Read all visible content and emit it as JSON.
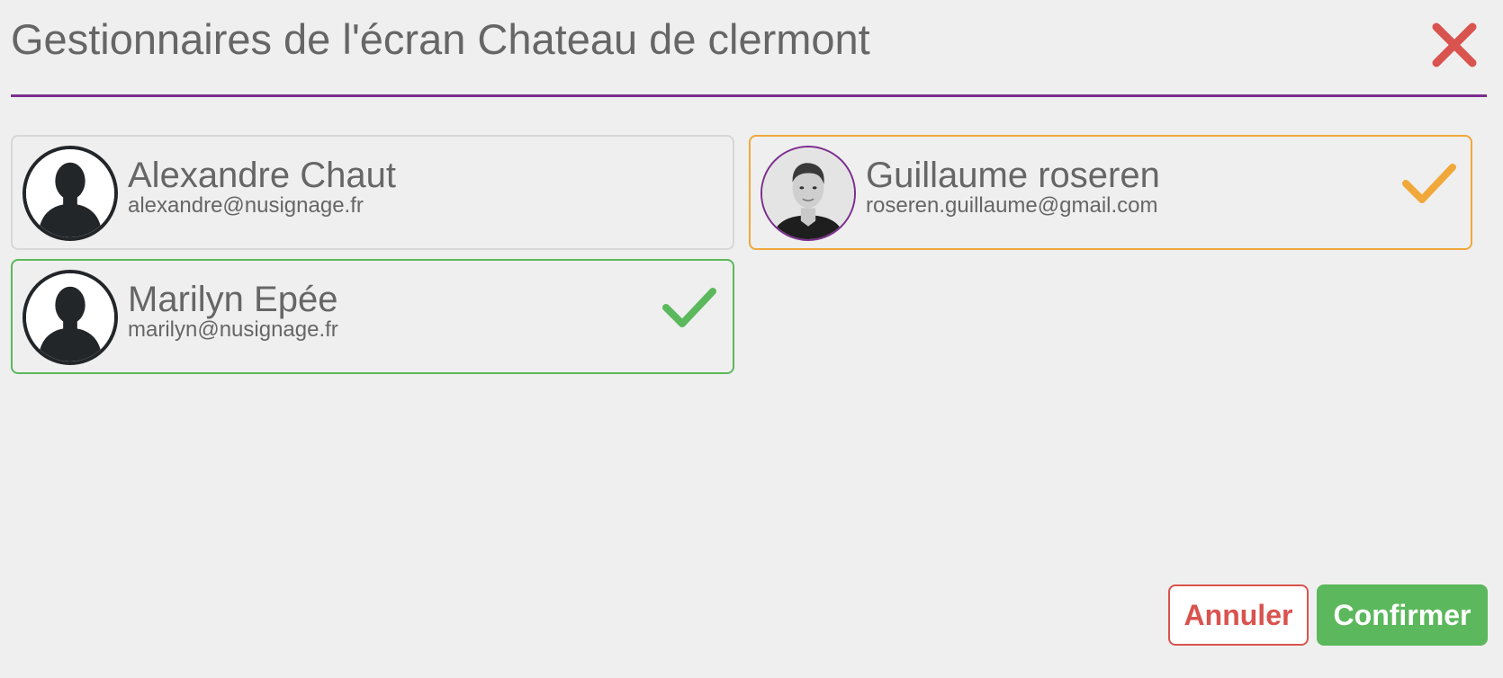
{
  "dialog": {
    "title": "Gestionnaires de l'écran Chateau de clermont"
  },
  "managers": [
    {
      "name": "Alexandre Chaut",
      "email": "alexandre@nusignage.fr",
      "avatar": "silhouette",
      "selected": false
    },
    {
      "name": "Guillaume roseren",
      "email": "roseren.guillaume@gmail.com",
      "avatar": "photo",
      "selected": true,
      "check_color": "#f0a83a"
    },
    {
      "name": "Marilyn Epée",
      "email": "marilyn@nusignage.fr",
      "avatar": "silhouette",
      "selected": true,
      "check_color": "#5cb85c"
    }
  ],
  "buttons": {
    "cancel_label": "Annuler",
    "confirm_label": "Confirmer"
  },
  "colors": {
    "accent": "#7b2d8e",
    "close": "#d9534f",
    "confirm": "#5cb85c",
    "orange": "#f0a83a"
  },
  "icons": {
    "close": "close-icon",
    "check": "check-icon",
    "avatar": "user-silhouette-icon"
  }
}
